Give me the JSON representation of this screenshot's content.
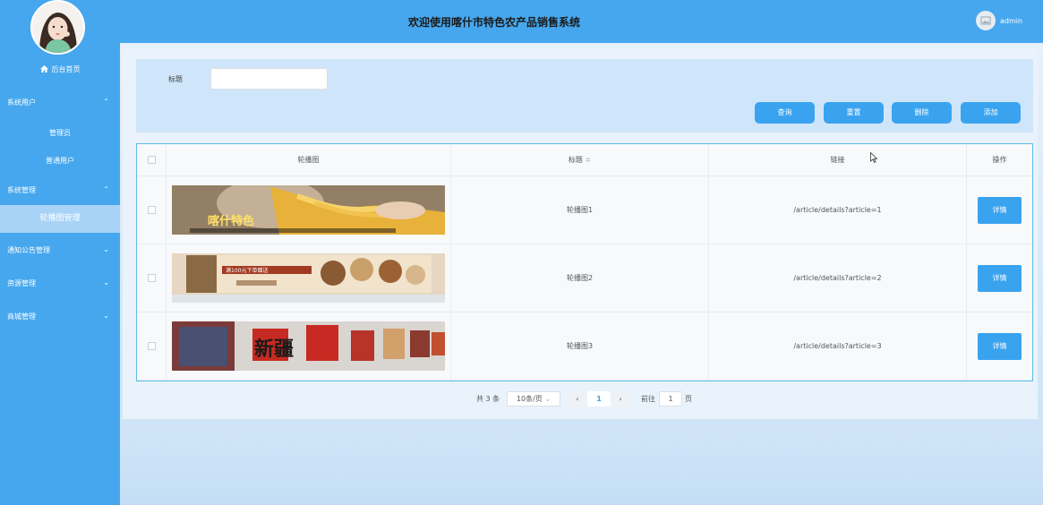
{
  "header": {
    "title": "欢迎使用喀什市特色农产品销售系统",
    "username": "admin"
  },
  "sidebar": {
    "home": "后台首页",
    "groups": [
      {
        "label": "系统用户",
        "chevron": "^"
      },
      {
        "label": "系统管理",
        "chevron": "^"
      },
      {
        "label": "通知公告管理",
        "chevron": "v"
      },
      {
        "label": "资源管理",
        "chevron": "v"
      },
      {
        "label": "商城管理",
        "chevron": "v"
      }
    ],
    "subitems": [
      "管理员",
      "普通用户"
    ],
    "active": "轮播图管理"
  },
  "search": {
    "label": "标题",
    "value": "",
    "placeholder": ""
  },
  "buttons": {
    "query": "查询",
    "reset": "重置",
    "delete": "删除",
    "add": "添加"
  },
  "table": {
    "headers": [
      "轮播图",
      "标题",
      "链接",
      "操作"
    ],
    "sort_icon": "≑",
    "rows": [
      {
        "title": "轮播图1",
        "link": "/article/details?article=1",
        "action": "详情",
        "img_text": "喀什特色"
      },
      {
        "title": "轮播图2",
        "link": "/article/details?article=2",
        "action": "详情",
        "img_text": "满100元下单赠送"
      },
      {
        "title": "轮播图3",
        "link": "/article/details?article=3",
        "action": "详情",
        "img_text": "新疆"
      }
    ]
  },
  "pagination": {
    "total": "共 3 条",
    "page_size": "10条/页",
    "prev": "‹",
    "page": "1",
    "next": "›",
    "goto": "前往",
    "goto_value": "1",
    "unit": "页"
  },
  "colors": {
    "primary": "#46a7ee",
    "button": "#3aa3ef",
    "active_item": "#a8d3f6"
  }
}
